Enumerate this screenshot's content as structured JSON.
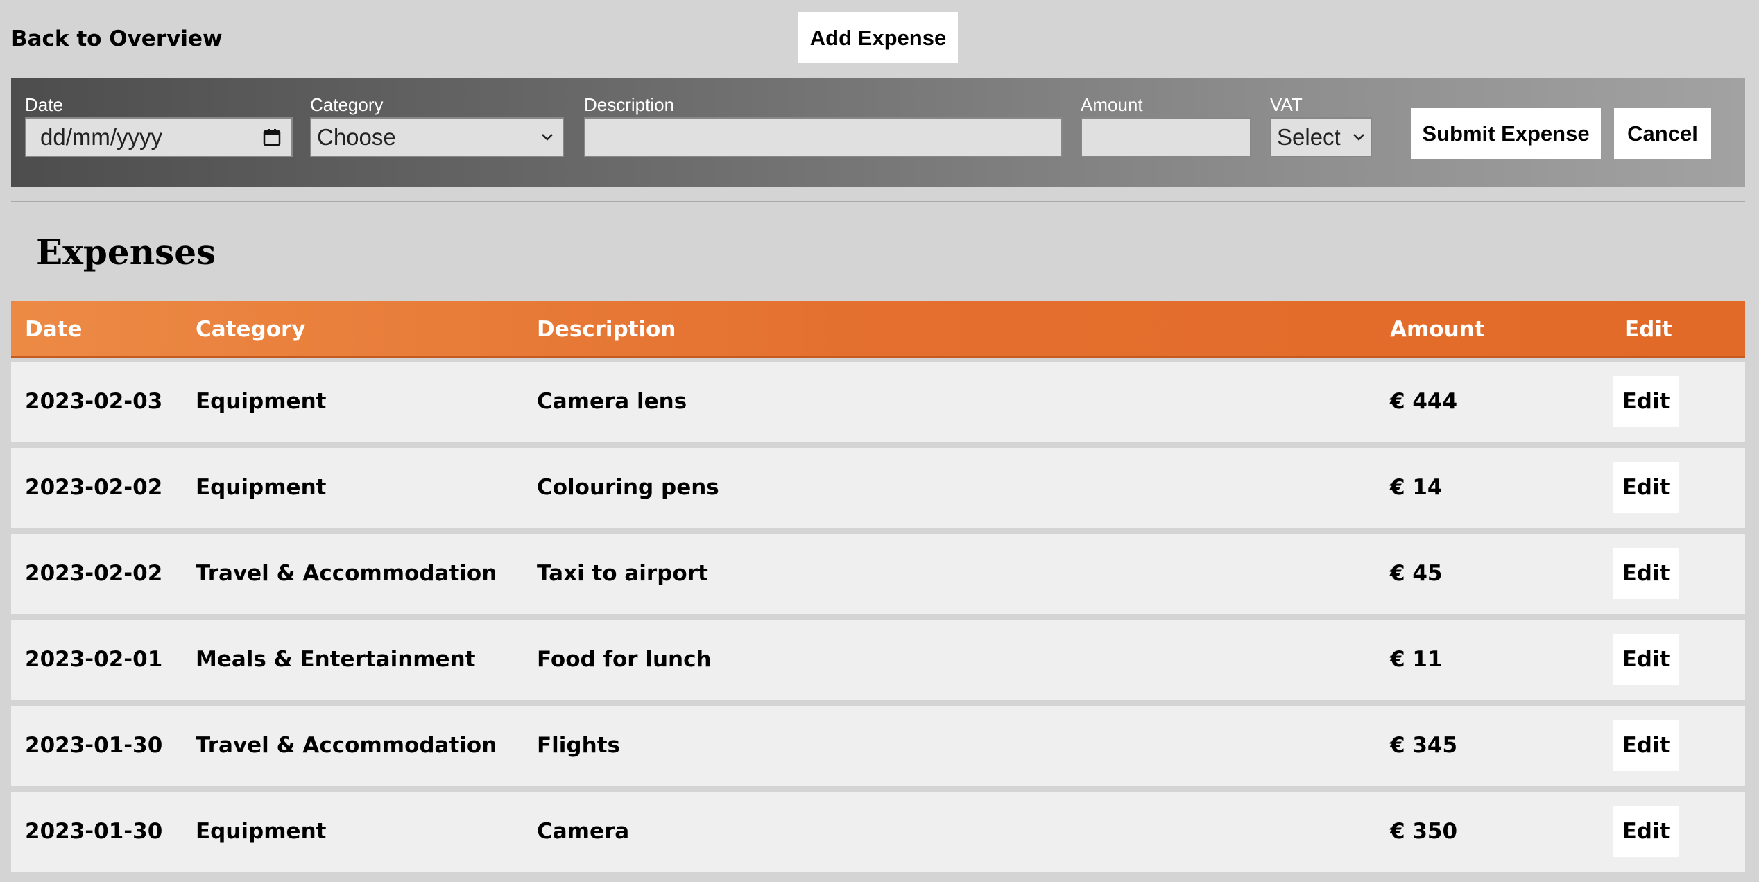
{
  "nav": {
    "back_label": "Back to Overview",
    "add_label": "Add Expense"
  },
  "form": {
    "date": {
      "label": "Date",
      "value": "dd/mm/yyyy",
      "icon": "calendar-icon"
    },
    "category": {
      "label": "Category",
      "value": "Choose"
    },
    "description": {
      "label": "Description",
      "value": ""
    },
    "amount": {
      "label": "Amount",
      "value": ""
    },
    "vat": {
      "label": "VAT",
      "value": "Select"
    },
    "submit_label": "Submit Expense",
    "cancel_label": "Cancel"
  },
  "section_title": "Expenses",
  "colors": {
    "header_orange": "#e46f2e",
    "background": "#d4d4d4",
    "row": "#efefef"
  },
  "table": {
    "headers": {
      "date": "Date",
      "category": "Category",
      "description": "Description",
      "amount": "Amount",
      "edit": "Edit"
    },
    "rows": [
      {
        "date": "2023-02-03",
        "category": "Equipment",
        "description": "Camera lens",
        "amount": "€ 444",
        "edit": "Edit"
      },
      {
        "date": "2023-02-02",
        "category": "Equipment",
        "description": "Colouring pens",
        "amount": "€ 14",
        "edit": "Edit"
      },
      {
        "date": "2023-02-02",
        "category": "Travel & Accommodation",
        "description": "Taxi to airport",
        "amount": "€ 45",
        "edit": "Edit"
      },
      {
        "date": "2023-02-01",
        "category": "Meals & Entertainment",
        "description": "Food for lunch",
        "amount": "€ 11",
        "edit": "Edit"
      },
      {
        "date": "2023-01-30",
        "category": "Travel & Accommodation",
        "description": "Flights",
        "amount": "€ 345",
        "edit": "Edit"
      },
      {
        "date": "2023-01-30",
        "category": "Equipment",
        "description": "Camera",
        "amount": "€ 350",
        "edit": "Edit"
      }
    ]
  }
}
